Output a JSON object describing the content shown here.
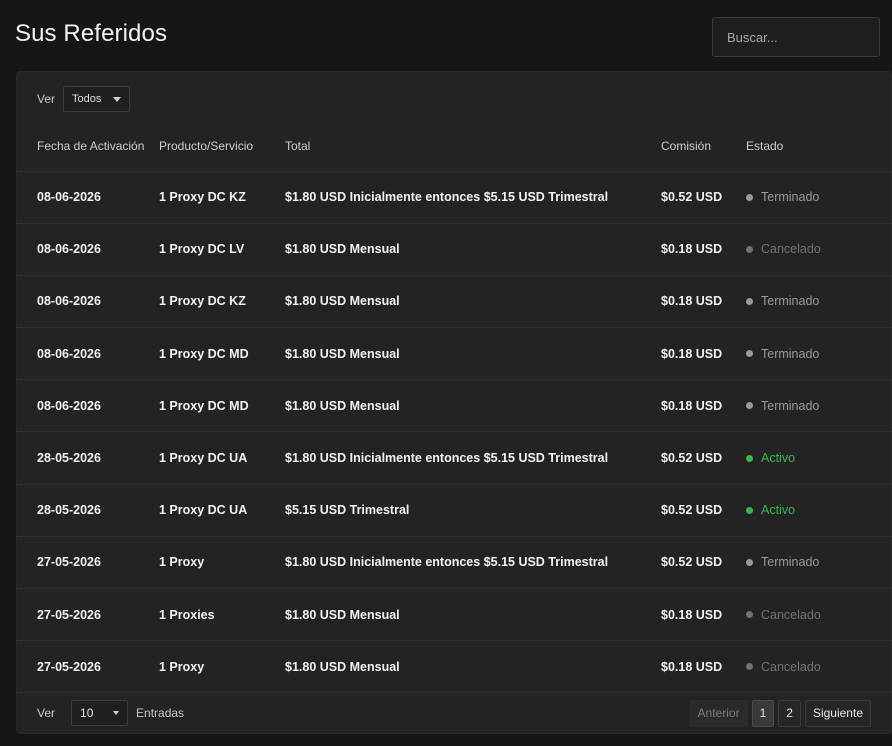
{
  "header": {
    "title": "Sus Referidos",
    "search_placeholder": "Buscar..."
  },
  "filter": {
    "label": "Ver",
    "value": "Todos"
  },
  "table": {
    "columns": [
      "Fecha de Activación",
      "Producto/Servicio",
      "Total",
      "Comisión",
      "Estado"
    ],
    "rows": [
      {
        "date": "08-06-2026",
        "product": "1 Proxy DC KZ",
        "total": "$1.80 USD Inicialmente entonces $5.15 USD Trimestral",
        "commission": "$0.52 USD",
        "status": "Terminado",
        "status_type": "terminated"
      },
      {
        "date": "08-06-2026",
        "product": "1 Proxy DC LV",
        "total": "$1.80 USD Mensual",
        "commission": "$0.18 USD",
        "status": "Cancelado",
        "status_type": "cancelled"
      },
      {
        "date": "08-06-2026",
        "product": "1 Proxy DC KZ",
        "total": "$1.80 USD Mensual",
        "commission": "$0.18 USD",
        "status": "Terminado",
        "status_type": "terminated"
      },
      {
        "date": "08-06-2026",
        "product": "1 Proxy DC MD",
        "total": "$1.80 USD Mensual",
        "commission": "$0.18 USD",
        "status": "Terminado",
        "status_type": "terminated"
      },
      {
        "date": "08-06-2026",
        "product": "1 Proxy DC MD",
        "total": "$1.80 USD Mensual",
        "commission": "$0.18 USD",
        "status": "Terminado",
        "status_type": "terminated"
      },
      {
        "date": "28-05-2026",
        "product": "1 Proxy DC UA",
        "total": "$1.80 USD Inicialmente entonces $5.15 USD Trimestral",
        "commission": "$0.52 USD",
        "status": "Activo",
        "status_type": "active"
      },
      {
        "date": "28-05-2026",
        "product": "1 Proxy DC UA",
        "total": "$5.15 USD Trimestral",
        "commission": "$0.52 USD",
        "status": "Activo",
        "status_type": "active"
      },
      {
        "date": "27-05-2026",
        "product": "1 Proxy",
        "total": "$1.80 USD Inicialmente entonces $5.15 USD Trimestral",
        "commission": "$0.52 USD",
        "status": "Terminado",
        "status_type": "terminated"
      },
      {
        "date": "27-05-2026",
        "product": "1 Proxies",
        "total": "$1.80 USD Mensual",
        "commission": "$0.18 USD",
        "status": "Cancelado",
        "status_type": "cancelled"
      },
      {
        "date": "27-05-2026",
        "product": "1 Proxy",
        "total": "$1.80 USD Mensual",
        "commission": "$0.18 USD",
        "status": "Cancelado",
        "status_type": "cancelled"
      }
    ]
  },
  "footer": {
    "show_label": "Ver",
    "page_length": "10",
    "entries_label": "Entradas",
    "prev_label": "Anterior",
    "pages": [
      "1",
      "2"
    ],
    "current_page": "1",
    "next_label": "Siguiente"
  },
  "colors": {
    "background": "#161616",
    "panel": "#232323",
    "active_status": "#3fb34f",
    "terminated_status": "#9a9a9a",
    "cancelled_status": "#727272"
  }
}
